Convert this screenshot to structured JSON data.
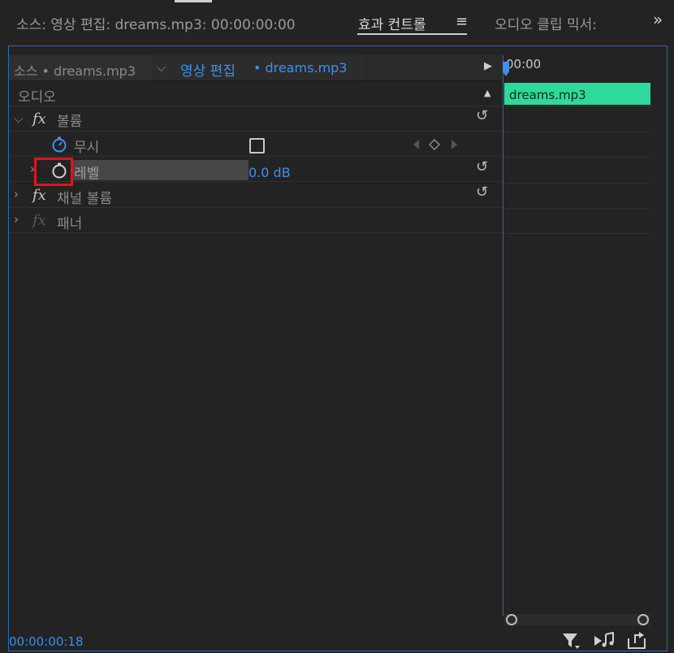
{
  "top_tabs": {
    "source": "소스: 영상 편집: dreams.mp3: 00:00:00:00",
    "effect_controls": "효과 컨트롤",
    "audio_clip_mixer": "오디오 클립 믹서:",
    "menu_glyph": "≡",
    "overflow_glyph": "»"
  },
  "source_bar": {
    "source_tab": "소스 • dreams.mp3",
    "sequence_tab_name": "영상 편집",
    "sequence_tab_clip": "• dreams.mp3",
    "dropdown_glyph": "⌵",
    "play_glyph": "▶"
  },
  "effects": {
    "section_title": "오디오",
    "collapse_glyph": "▲",
    "volume": {
      "fx": "fx",
      "label": "볼륨"
    },
    "mute": {
      "label": "무시",
      "checked": false
    },
    "level": {
      "label": "레벨",
      "value": "0.0 dB"
    },
    "channel_volume": {
      "fx": "fx",
      "label": "채널 볼륨"
    },
    "panner": {
      "fx": "fx",
      "label": "패너"
    },
    "reset_glyph": "↺",
    "chevron_down": "⌵",
    "chevron_right": "›"
  },
  "timeline": {
    "time_label": "00:00",
    "clip_name": "dreams.mp3"
  },
  "footer": {
    "timecode": "00:00:00:18"
  },
  "icons": {
    "stopwatch_on": "stopwatch-icon",
    "stopwatch_off": "stopwatch-icon",
    "filter": "filter-icon",
    "play_audio": "play-audio-icon",
    "export": "export-icon"
  },
  "colors": {
    "accent_blue": "#3d90ec",
    "clip_green": "#2ed99b",
    "highlight_red": "#e1131b"
  }
}
